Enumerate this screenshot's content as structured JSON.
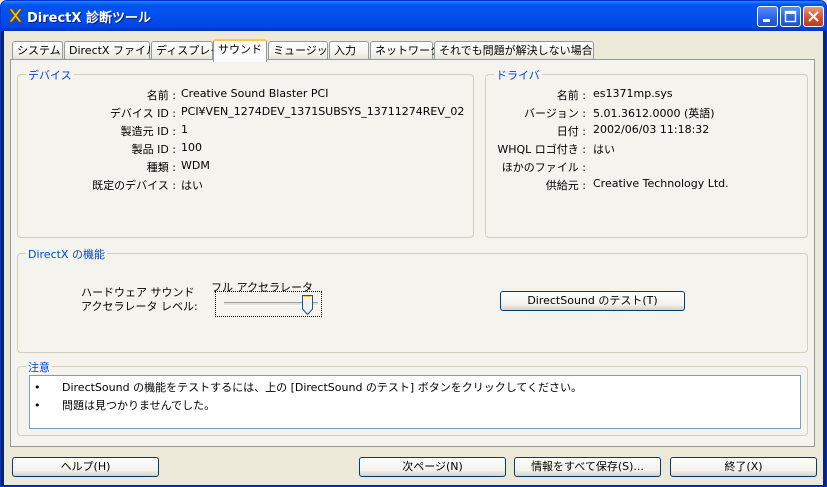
{
  "window": {
    "title": "DirectX 診断ツール"
  },
  "tabs": [
    "システム",
    "DirectX ファイル",
    "ディスプレイ",
    "サウンド",
    "ミュージック",
    "入力",
    "ネットワーク",
    "それでも問題が解決しない場合"
  ],
  "device": {
    "legend": "デバイス",
    "fields": [
      {
        "label": "名前 :",
        "value": "Creative Sound Blaster PCI"
      },
      {
        "label": "デバイス ID :",
        "value": "PCI¥VEN_1274DEV_1371SUBSYS_13711274REV_02"
      },
      {
        "label": "製造元 ID :",
        "value": "1"
      },
      {
        "label": "製品 ID :",
        "value": "100"
      },
      {
        "label": "種類 :",
        "value": "WDM"
      },
      {
        "label": "既定のデバイス :",
        "value": "はい"
      }
    ]
  },
  "driver": {
    "legend": "ドライバ",
    "fields": [
      {
        "label": "名前 :",
        "value": "es1371mp.sys"
      },
      {
        "label": "バージョン :",
        "value": "5.01.3612.0000 (英語)"
      },
      {
        "label": "日付 :",
        "value": "2002/06/03 11:18:32"
      },
      {
        "label": "WHQL ロゴ付き :",
        "value": "はい"
      },
      {
        "label": "ほかのファイル :",
        "value": ""
      },
      {
        "label": "供給元 :",
        "value": "Creative Technology Ltd."
      }
    ]
  },
  "features": {
    "legend": "DirectX の機能",
    "accel_label_line1": "ハードウェア サウンド",
    "accel_label_line2": "アクセラレータ レベル:",
    "slider_caption": "フル アクセラレータ",
    "slider_level_fraction": 1.0,
    "test_button": "DirectSound のテスト(T)"
  },
  "notes": {
    "legend": "注意",
    "bullet": "•",
    "lines": [
      "DirectSound の機能をテストするには、上の [DirectSound のテスト] ボタンをクリックしてください。",
      "問題は見つかりませんでした。"
    ]
  },
  "buttons": {
    "help": "ヘルプ(H)",
    "next": "次ページ(N)",
    "save": "情報をすべて保存(S)...",
    "exit": "終了(X)"
  },
  "colors": {
    "titlebar": "#0053EE",
    "legend_text": "#0046D5",
    "tab_highlight": "#FFC83C",
    "face": "#ECE9D8"
  }
}
